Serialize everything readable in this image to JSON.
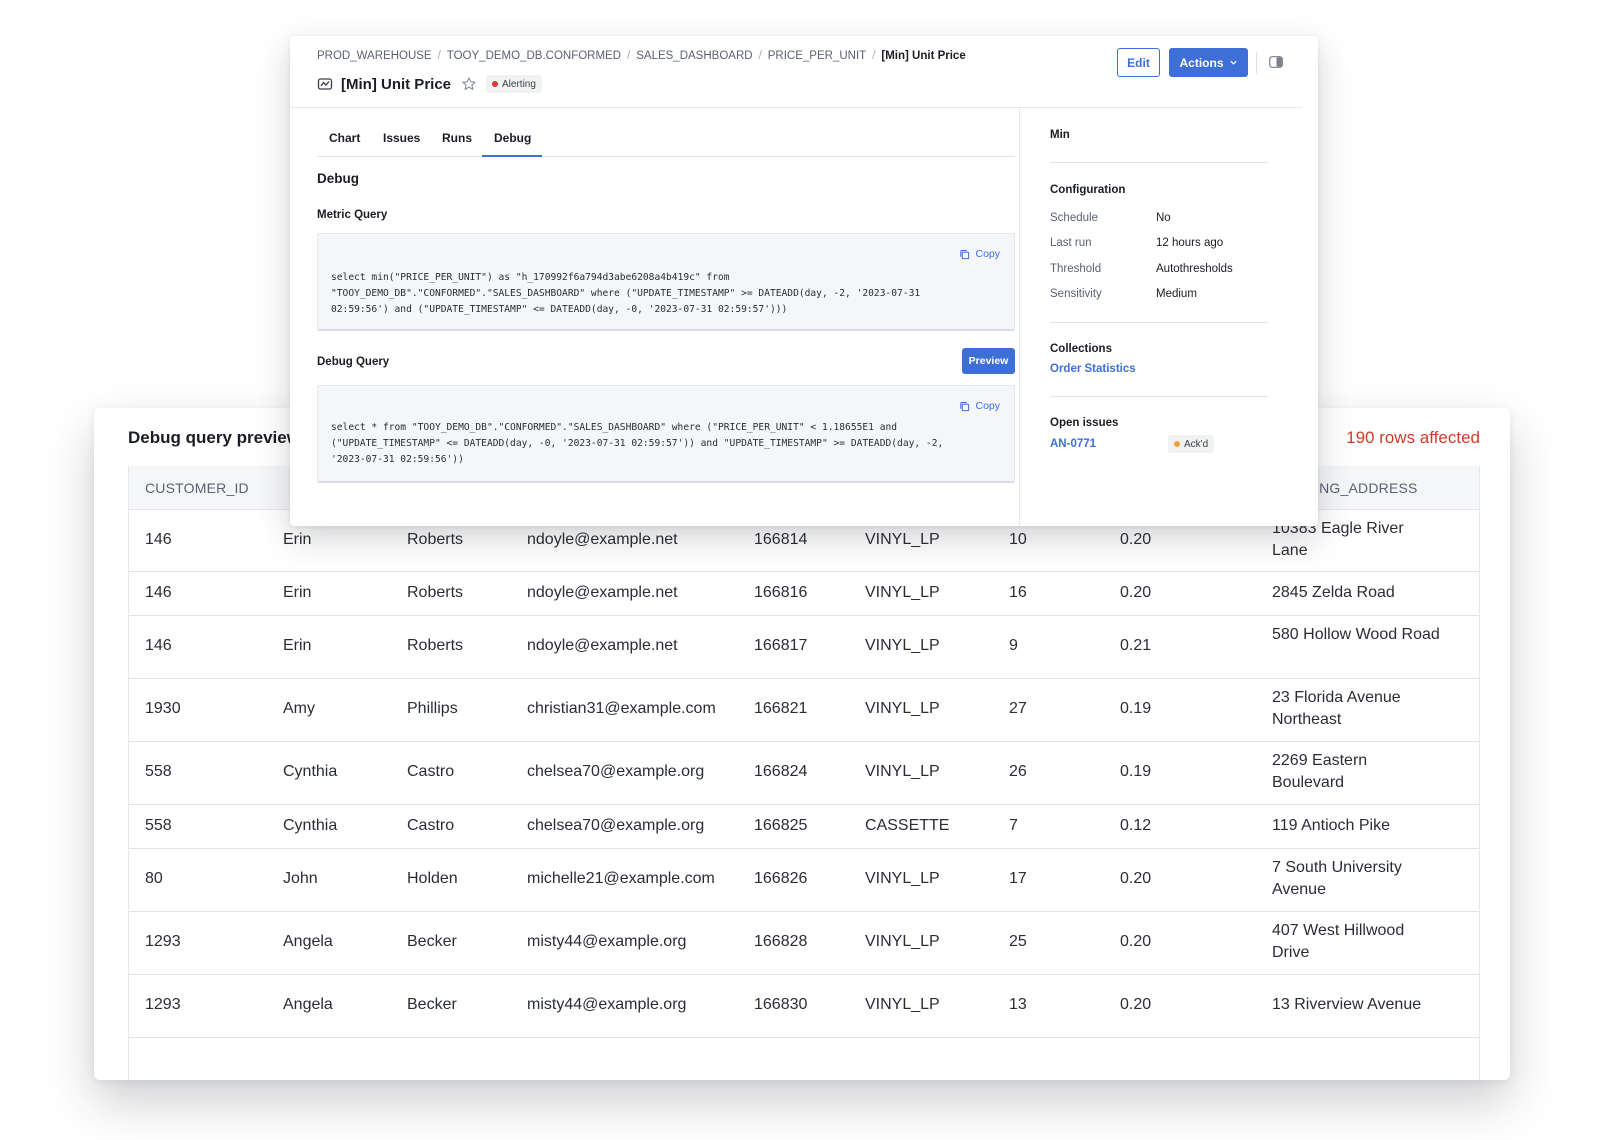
{
  "preview": {
    "title": "Debug query preview",
    "rows_affected": "190 rows affected",
    "columns": [
      "CUSTOMER_ID",
      "",
      "",
      "",
      "",
      "",
      "",
      "",
      "SHIPPING_ADDRESS"
    ],
    "rows": [
      [
        "146",
        "Erin",
        "Roberts",
        "ndoyle@example.net",
        "166814",
        "VINYL_LP",
        "10",
        "0.20",
        "10383 Eagle River Lane"
      ],
      [
        "146",
        "Erin",
        "Roberts",
        "ndoyle@example.net",
        "166816",
        "VINYL_LP",
        "16",
        "0.20",
        "2845 Zelda Road"
      ],
      [
        "146",
        "Erin",
        "Roberts",
        "ndoyle@example.net",
        "166817",
        "VINYL_LP",
        "9",
        "0.21",
        "580 Hollow Wood Road"
      ],
      [
        "1930",
        "Amy",
        "Phillips",
        "christian31@example.com",
        "166821",
        "VINYL_LP",
        "27",
        "0.19",
        "23 Florida Avenue Northeast"
      ],
      [
        "558",
        "Cynthia",
        "Castro",
        "chelsea70@example.org",
        "166824",
        "VINYL_LP",
        "26",
        "0.19",
        "2269 Eastern Boulevard"
      ],
      [
        "558",
        "Cynthia",
        "Castro",
        "chelsea70@example.org",
        "166825",
        "CASSETTE",
        "7",
        "0.12",
        "119 Antioch Pike"
      ],
      [
        "80",
        "John",
        "Holden",
        "michelle21@example.com",
        "166826",
        "VINYL_LP",
        "17",
        "0.20",
        "7 South University Avenue"
      ],
      [
        "1293",
        "Angela",
        "Becker",
        "misty44@example.org",
        "166828",
        "VINYL_LP",
        "25",
        "0.20",
        "407 West Hillwood Drive"
      ],
      [
        "1293",
        "Angela",
        "Becker",
        "misty44@example.org",
        "166830",
        "VINYL_LP",
        "13",
        "0.20",
        "13 Riverview Avenue"
      ]
    ]
  },
  "breadcrumb": [
    "PROD_WAREHOUSE",
    "TOOY_DEMO_DB.CONFORMED",
    "SALES_DASHBOARD",
    "PRICE_PER_UNIT",
    "[Min] Unit Price"
  ],
  "header": {
    "title": "[Min] Unit Price",
    "status_badge": "Alerting",
    "edit_label": "Edit",
    "actions_label": "Actions"
  },
  "tabs": [
    "Chart",
    "Issues",
    "Runs",
    "Debug"
  ],
  "active_tab": "Debug",
  "debug": {
    "heading": "Debug",
    "metric_query_label": "Metric Query",
    "metric_query": "select min(\"PRICE_PER_UNIT\") as \"h_170992f6a794d3abe6208a4b419c\" from\n\"TOOY_DEMO_DB\".\"CONFORMED\".\"SALES_DASHBOARD\" where (\"UPDATE_TIMESTAMP\" >= DATEADD(day, -2, '2023-07-31\n02:59:56') and (\"UPDATE_TIMESTAMP\" <= DATEADD(day, -0, '2023-07-31 02:59:57')))",
    "debug_query_label": "Debug Query",
    "preview_label": "Preview",
    "debug_query": "select * from \"TOOY_DEMO_DB\".\"CONFORMED\".\"SALES_DASHBOARD\" where (\"PRICE_PER_UNIT\" < 1.18655E1 and\n(\"UPDATE_TIMESTAMP\" <= DATEADD(day, -0, '2023-07-31 02:59:57')) and \"UPDATE_TIMESTAMP\" >= DATEADD(day, -2,\n'2023-07-31 02:59:56'))",
    "copy_label": "Copy"
  },
  "sidebar": {
    "aggregate": "Min",
    "configuration_label": "Configuration",
    "config": [
      {
        "key": "Schedule",
        "value": "No"
      },
      {
        "key": "Last run",
        "value": "12 hours ago"
      },
      {
        "key": "Threshold",
        "value": "Autothresholds"
      },
      {
        "key": "Sensitivity",
        "value": "Medium"
      }
    ],
    "collections_label": "Collections",
    "collection": "Order Statistics",
    "open_issues_label": "Open issues",
    "issue_id": "AN-0771",
    "issue_status": "Ack'd"
  },
  "colors": {
    "accent": "#3d6fd6",
    "alert_dot": "#d63a2f",
    "ack_dot": "#f0a33a",
    "rows_affected": "#d23a2a"
  }
}
